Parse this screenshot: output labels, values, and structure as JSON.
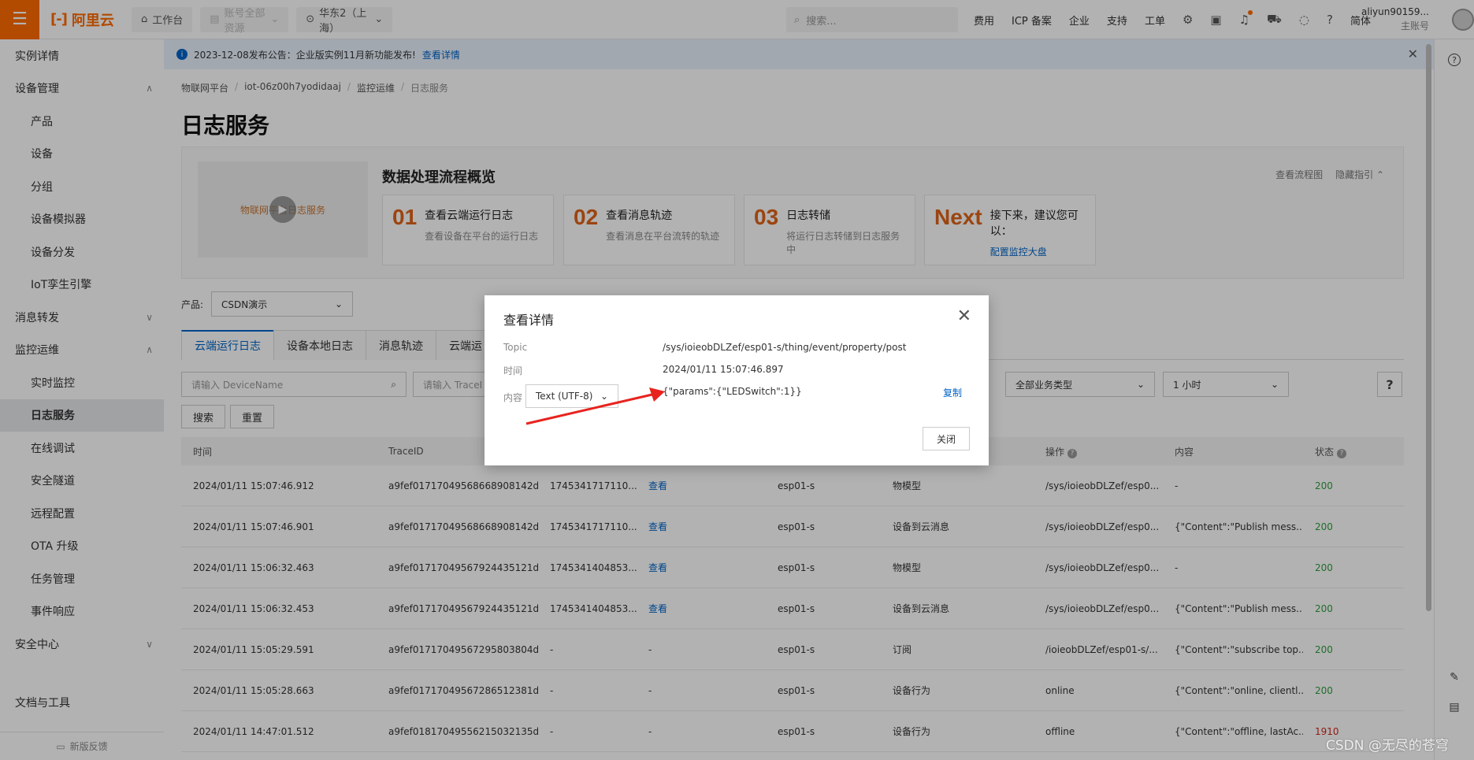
{
  "topbar": {
    "logo_text": "阿里云",
    "workbench": "工作台",
    "account_scope": "账号全部资源",
    "region": "华东2（上海）",
    "search_placeholder": "搜索...",
    "links": [
      "费用",
      "ICP 备案",
      "企业",
      "支持",
      "工单"
    ],
    "language": "简体",
    "username": "aliyun90159...",
    "account_type": "主账号"
  },
  "sidebar": {
    "items": [
      {
        "label": "实例详情",
        "sub": false,
        "chevron": ""
      },
      {
        "label": "设备管理",
        "sub": false,
        "chevron": "∧"
      },
      {
        "label": "产品",
        "sub": true,
        "chevron": ""
      },
      {
        "label": "设备",
        "sub": true,
        "chevron": ""
      },
      {
        "label": "分组",
        "sub": true,
        "chevron": ""
      },
      {
        "label": "设备模拟器",
        "sub": true,
        "chevron": ""
      },
      {
        "label": "设备分发",
        "sub": true,
        "chevron": ""
      },
      {
        "label": "IoT孪生引擎",
        "sub": true,
        "chevron": ""
      },
      {
        "label": "消息转发",
        "sub": false,
        "chevron": "∨"
      },
      {
        "label": "监控运维",
        "sub": false,
        "chevron": "∧"
      },
      {
        "label": "实时监控",
        "sub": true,
        "chevron": ""
      },
      {
        "label": "日志服务",
        "sub": true,
        "chevron": "",
        "active": true
      },
      {
        "label": "在线调试",
        "sub": true,
        "chevron": ""
      },
      {
        "label": "安全隧道",
        "sub": true,
        "chevron": ""
      },
      {
        "label": "远程配置",
        "sub": true,
        "chevron": ""
      },
      {
        "label": "OTA 升级",
        "sub": true,
        "chevron": ""
      },
      {
        "label": "任务管理",
        "sub": true,
        "chevron": ""
      },
      {
        "label": "事件响应",
        "sub": true,
        "chevron": ""
      },
      {
        "label": "安全中心",
        "sub": false,
        "chevron": "∨"
      }
    ],
    "docs_tools": "文档与工具",
    "feedback": "新版反馈"
  },
  "notice": {
    "text": "2023-12-08发布公告：企业版实例11月新功能发布!",
    "link": "查看详情"
  },
  "breadcrumb": [
    "物联网平台",
    "iot-06z00h7yodidaaj",
    "监控运维",
    "日志服务"
  ],
  "page_title": "日志服务",
  "flow": {
    "video_caption": "物联网平台日志服务",
    "title": "数据处理流程概览",
    "view_flow": "查看流程图",
    "hide_guide": "隐藏指引",
    "cards": [
      {
        "num": "01",
        "title": "查看云端运行日志",
        "desc": "查看设备在平台的运行日志"
      },
      {
        "num": "02",
        "title": "查看消息轨迹",
        "desc": "查看消息在平台流转的轨迹"
      },
      {
        "num": "03",
        "title": "日志转储",
        "desc": "将运行日志转储到日志服务中"
      },
      {
        "num": "Next",
        "title": "接下来，建议您可以：",
        "link": "配置监控大盘"
      }
    ]
  },
  "filters": {
    "product_label": "产品:",
    "product_value": "CSDN演示",
    "tabs": [
      "云端运行日志",
      "设备本地日志",
      "消息轨迹",
      "云端运"
    ],
    "device_placeholder": "请输入 DeviceName",
    "trace_placeholder": "请输入 TraceI",
    "biz_type": "全部业务类型",
    "time_range": "1 小时",
    "search_btn": "搜索",
    "reset_btn": "重置"
  },
  "table": {
    "columns": [
      "时间",
      "TraceID",
      "",
      "",
      "",
      "",
      "操作",
      "内容",
      "状态"
    ],
    "rows": [
      [
        "2024/01/11 15:07:46.912",
        "a9fef01717049568668908142d...",
        "1745341717110...",
        "查看",
        "esp01-s",
        "物模型",
        "/sys/ioieobDLZef/esp0...",
        "-",
        "200"
      ],
      [
        "2024/01/11 15:07:46.901",
        "a9fef01717049568668908142d...",
        "1745341717110...",
        "查看",
        "esp01-s",
        "设备到云消息",
        "/sys/ioieobDLZef/esp0...",
        "{\"Content\":\"Publish mess...",
        "200"
      ],
      [
        "2024/01/11 15:06:32.463",
        "a9fef01717049567924435121d...",
        "1745341404853...",
        "查看",
        "esp01-s",
        "物模型",
        "/sys/ioieobDLZef/esp0...",
        "-",
        "200"
      ],
      [
        "2024/01/11 15:06:32.453",
        "a9fef01717049567924435121d...",
        "1745341404853...",
        "查看",
        "esp01-s",
        "设备到云消息",
        "/sys/ioieobDLZef/esp0...",
        "{\"Content\":\"Publish mess...",
        "200"
      ],
      [
        "2024/01/11 15:05:29.591",
        "a9fef01717049567295803804d...",
        "-",
        "-",
        "esp01-s",
        "订阅",
        "/ioieobDLZef/esp01-s/...",
        "{\"Content\":\"subscribe top...",
        "200"
      ],
      [
        "2024/01/11 15:05:28.663",
        "a9fef01717049567286512381d...",
        "-",
        "-",
        "esp01-s",
        "设备行为",
        "online",
        "{\"Content\":\"online, clientl...",
        "200"
      ],
      [
        "2024/01/11 14:47:01.512",
        "a9fef01817049556215032135d...",
        "-",
        "-",
        "esp01-s",
        "设备行为",
        "offline",
        "{\"Content\":\"offline, lastAc...",
        "1910"
      ]
    ]
  },
  "modal": {
    "title": "查看详情",
    "topic_label": "Topic",
    "topic_value": "/sys/ioieobDLZef/esp01-s/thing/event/property/post",
    "time_label": "时间",
    "time_value": "2024/01/11 15:07:46.897",
    "content_label": "内容",
    "encoding": "Text (UTF-8)",
    "content_value": "{\"params\":{\"LEDSwitch\":1}}",
    "copy": "复制",
    "close_btn": "关闭"
  },
  "watermark": "CSDN @无尽的苍穹",
  "colors": {
    "accent": "#ff6a00",
    "link": "#0064c8",
    "ok": "#2e9e3d",
    "error": "#d0281b",
    "arrow": "#e8231e"
  }
}
